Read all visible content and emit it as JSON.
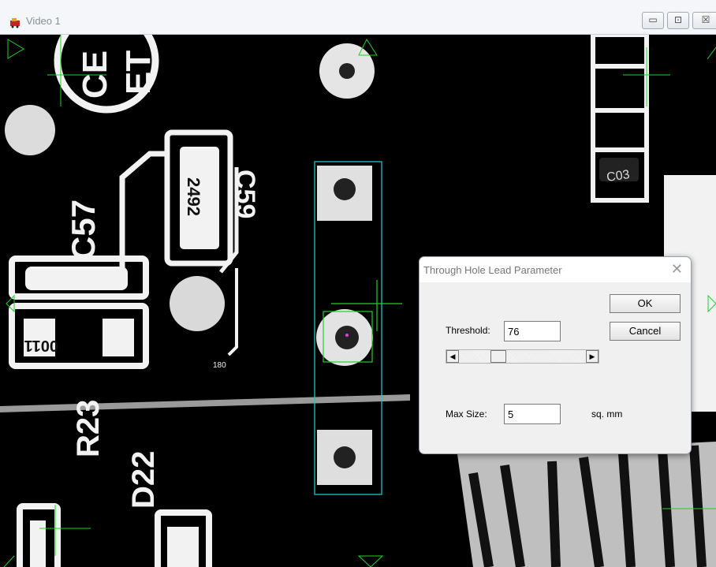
{
  "window": {
    "title": "Video 1",
    "controls": {
      "minimize": "▭",
      "maximize": "⊡",
      "close": "☒"
    }
  },
  "pcb_silkscreen": {
    "ce_line1": "CE",
    "ce_line2": "ET",
    "c57": "C57",
    "resistor_code": "2492",
    "c59": "C59",
    "r23": "R23",
    "d22": "D22",
    "part_0011": "0011",
    "small_mark": "180",
    "component_mark": "C03"
  },
  "dialog": {
    "title": "Through Hole Lead Parameter",
    "close_glyph": "✕",
    "ok_label": "OK",
    "cancel_label": "Cancel",
    "threshold_label": "Threshold:",
    "threshold_value": "76",
    "max_size_label": "Max Size:",
    "max_size_value": "5",
    "max_size_unit": "sq. mm",
    "slider_left_arrow": "◀",
    "slider_right_arrow": "▶"
  },
  "colors": {
    "overlay_green": "#22d02a",
    "overlay_cyan": "#29bfc6",
    "pcb_white": "#f2f2f2",
    "background": "#000000"
  }
}
